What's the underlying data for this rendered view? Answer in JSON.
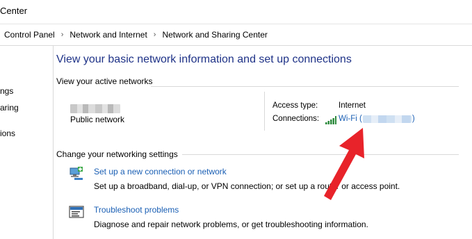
{
  "window": {
    "title": "Center"
  },
  "breadcrumb": [
    "Control Panel",
    "Network and Internet",
    "Network and Sharing Center"
  ],
  "sidebar": {
    "items": [
      "ngs",
      "aring",
      "ions"
    ]
  },
  "main": {
    "title": "View your basic network information and set up connections",
    "active_networks": {
      "heading": "View your active networks",
      "network_type": "Public network",
      "access_type_label": "Access type:",
      "access_type_value": "Internet",
      "connections_label": "Connections:",
      "wifi_prefix": "Wi-Fi (",
      "wifi_suffix": ")"
    },
    "settings": {
      "heading": "Change your networking settings",
      "tasks": [
        {
          "icon": "new-connection-icon",
          "link": "Set up a new connection or network",
          "description": "Set up a broadband, dial-up, or VPN connection; or set up a router or access point."
        },
        {
          "icon": "troubleshoot-icon",
          "link": "Troubleshoot problems",
          "description": "Diagnose and repair network problems, or get troubleshooting information."
        }
      ]
    }
  },
  "annotation": {
    "icon": "red-arrow-icon",
    "color": "#e8232a"
  },
  "colors": {
    "title_blue": "#1e3287",
    "link_blue": "#1a5fb4"
  }
}
